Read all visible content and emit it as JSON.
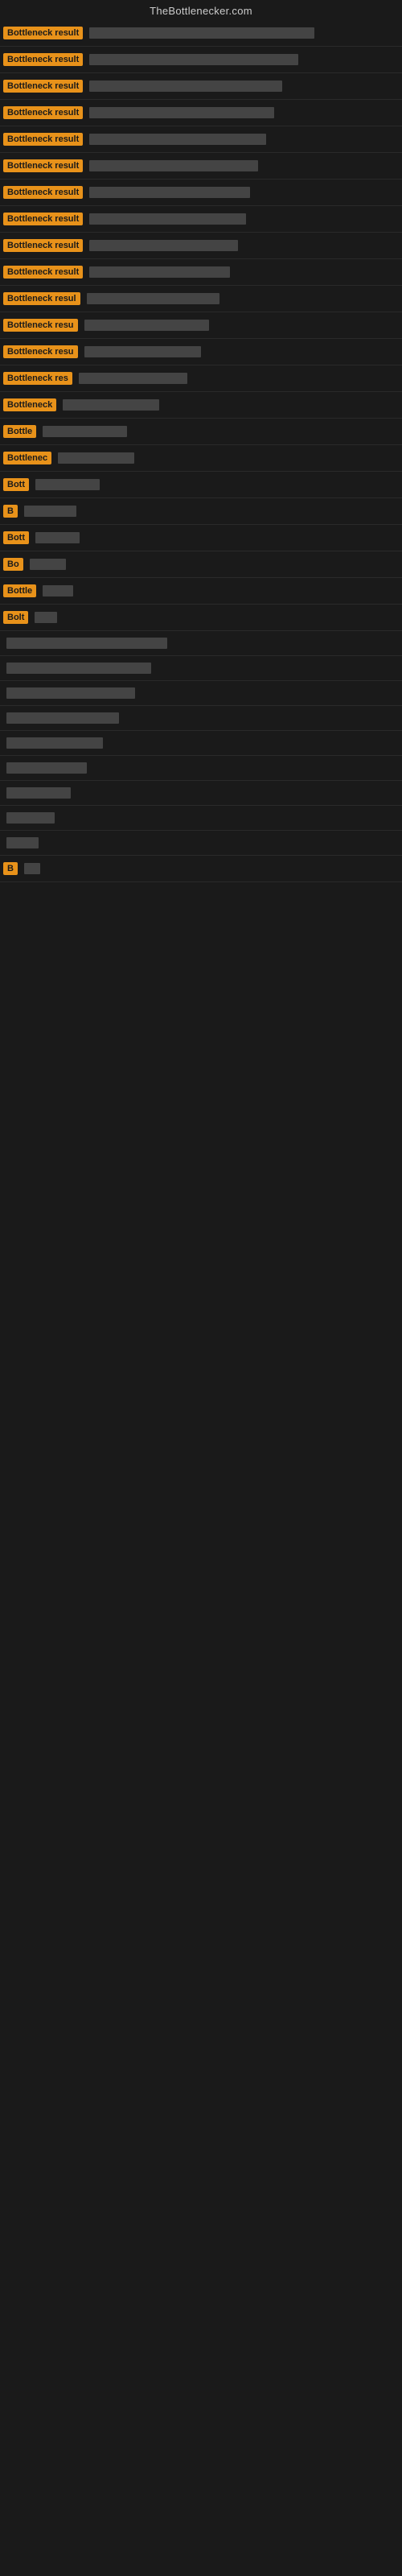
{
  "site": {
    "title": "TheBottlenecker.com"
  },
  "rows": [
    {
      "label": "Bottleneck result",
      "labelWidth": 120,
      "barWidth": 280
    },
    {
      "label": "Bottleneck result",
      "labelWidth": 120,
      "barWidth": 260
    },
    {
      "label": "Bottleneck result",
      "labelWidth": 120,
      "barWidth": 240
    },
    {
      "label": "Bottleneck result",
      "labelWidth": 120,
      "barWidth": 230
    },
    {
      "label": "Bottleneck result",
      "labelWidth": 120,
      "barWidth": 220
    },
    {
      "label": "Bottleneck result",
      "labelWidth": 120,
      "barWidth": 210
    },
    {
      "label": "Bottleneck result",
      "labelWidth": 120,
      "barWidth": 200
    },
    {
      "label": "Bottleneck result",
      "labelWidth": 120,
      "barWidth": 195
    },
    {
      "label": "Bottleneck result",
      "labelWidth": 120,
      "barWidth": 185
    },
    {
      "label": "Bottleneck result",
      "labelWidth": 120,
      "barWidth": 175
    },
    {
      "label": "Bottleneck resul",
      "labelWidth": 110,
      "barWidth": 165
    },
    {
      "label": "Bottleneck resu",
      "labelWidth": 105,
      "barWidth": 155
    },
    {
      "label": "Bottleneck resu",
      "labelWidth": 100,
      "barWidth": 145
    },
    {
      "label": "Bottleneck res",
      "labelWidth": 95,
      "barWidth": 135
    },
    {
      "label": "Bottleneck",
      "labelWidth": 75,
      "barWidth": 120
    },
    {
      "label": "Bottle",
      "labelWidth": 48,
      "barWidth": 105
    },
    {
      "label": "Bottlenec",
      "labelWidth": 65,
      "barWidth": 95
    },
    {
      "label": "Bott",
      "labelWidth": 34,
      "barWidth": 80
    },
    {
      "label": "B",
      "labelWidth": 12,
      "barWidth": 65
    },
    {
      "label": "Bott",
      "labelWidth": 34,
      "barWidth": 55
    },
    {
      "label": "Bo",
      "labelWidth": 20,
      "barWidth": 45
    },
    {
      "label": "Bottle",
      "labelWidth": 45,
      "barWidth": 38
    },
    {
      "label": "Bolt",
      "labelWidth": 32,
      "barWidth": 28
    },
    {
      "label": "",
      "labelWidth": 0,
      "barWidth": 200
    },
    {
      "label": "",
      "labelWidth": 0,
      "barWidth": 180
    },
    {
      "label": "",
      "labelWidth": 0,
      "barWidth": 160
    },
    {
      "label": "",
      "labelWidth": 0,
      "barWidth": 140
    },
    {
      "label": "",
      "labelWidth": 0,
      "barWidth": 120
    },
    {
      "label": "",
      "labelWidth": 0,
      "barWidth": 100
    },
    {
      "label": "",
      "labelWidth": 0,
      "barWidth": 80
    },
    {
      "label": "",
      "labelWidth": 0,
      "barWidth": 60
    },
    {
      "label": "",
      "labelWidth": 0,
      "barWidth": 40
    },
    {
      "label": "B",
      "labelWidth": 12,
      "barWidth": 20
    }
  ]
}
